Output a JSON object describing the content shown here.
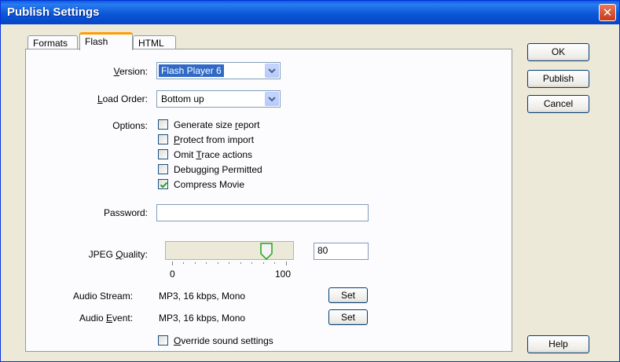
{
  "window": {
    "title": "Publish Settings",
    "close_glyph": "✕"
  },
  "tabs": [
    {
      "label": "Formats",
      "active": false
    },
    {
      "label": "Flash",
      "active": true
    },
    {
      "label": "HTML",
      "active": false
    }
  ],
  "version": {
    "label": "Version:",
    "value": "Flash Player 6"
  },
  "load_order": {
    "label": "Load Order:",
    "value": "Bottom up"
  },
  "options": {
    "label": "Options:",
    "items": [
      {
        "label": "Generate size report",
        "checked": false
      },
      {
        "label": "Protect from import",
        "checked": false
      },
      {
        "label": "Omit Trace actions",
        "checked": false
      },
      {
        "label": "Debugging Permitted",
        "checked": false
      },
      {
        "label": "Compress Movie",
        "checked": true
      }
    ]
  },
  "password": {
    "label": "Password:",
    "value": ""
  },
  "jpeg_quality": {
    "label": "JPEG Quality:",
    "value": "80",
    "slider_min_label": "0",
    "slider_max_label": "100",
    "slider_value": 80
  },
  "audio_stream": {
    "label": "Audio Stream:",
    "value": "MP3, 16 kbps, Mono",
    "button": "Set"
  },
  "audio_event": {
    "label": "Audio Event:",
    "value": "MP3, 16 kbps, Mono",
    "button": "Set"
  },
  "override_sound": {
    "label": "Override sound settings",
    "checked": false
  },
  "buttons": {
    "ok": "OK",
    "publish": "Publish",
    "cancel": "Cancel",
    "help": "Help"
  },
  "colors": {
    "title_bar": "#0a58d8",
    "dialog_bg": "#ece9d8",
    "selection": "#316ac5",
    "check": "#21a121"
  }
}
